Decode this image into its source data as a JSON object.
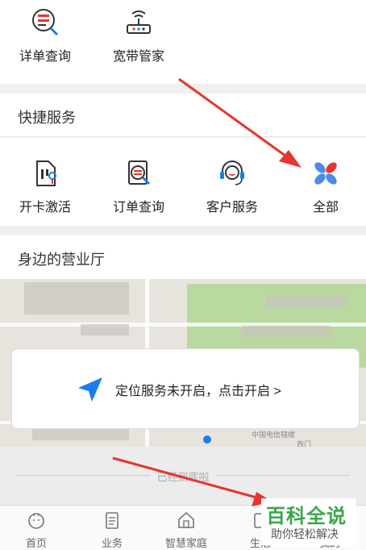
{
  "top_services": [
    {
      "label": "详单查询",
      "icon": "bill-search-icon"
    },
    {
      "label": "宽带管家",
      "icon": "router-icon"
    }
  ],
  "quick": {
    "title": "快捷服务",
    "items": [
      {
        "label": "开卡激活",
        "icon": "sim-card-icon"
      },
      {
        "label": "订单查询",
        "icon": "order-search-icon"
      },
      {
        "label": "客户服务",
        "icon": "headset-icon"
      },
      {
        "label": "全部",
        "icon": "petals-icon"
      }
    ]
  },
  "nearby": {
    "title": "身边的营业厅",
    "map_labels": [
      "中国电信辖楼",
      "西门"
    ],
    "location_prompt": "定位服务未开启，点击开启 >"
  },
  "end_text": "已经到底啦",
  "tabs": [
    {
      "label": "首页",
      "icon": "home-face-icon"
    },
    {
      "label": "业务",
      "icon": "clipboard-icon"
    },
    {
      "label": "智慧家庭",
      "icon": "house-icon"
    },
    {
      "label": "生活",
      "icon": "life-icon"
    },
    {
      "label": "我的",
      "icon": "user-icon"
    }
  ],
  "watermark": {
    "title": "百科全说",
    "subtitle": "助你轻松解决"
  },
  "colors": {
    "annotation_red": "#e8352f",
    "location_blue": "#1a7cf0",
    "map_green": "#b9d9a0",
    "watermark_green": "#3aa64a"
  }
}
